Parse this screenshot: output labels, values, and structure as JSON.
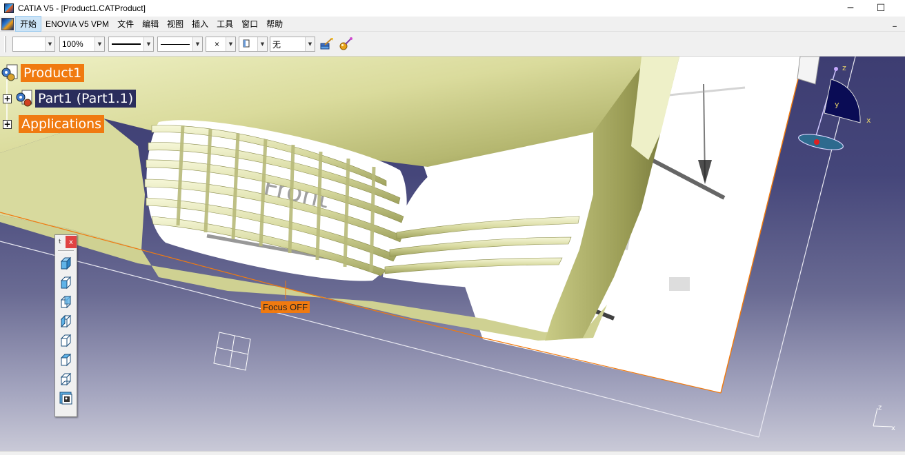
{
  "window": {
    "title": "CATIA V5 - [Product1.CATProduct]",
    "minimize_glyph": "─",
    "maximize_glyph": "☐"
  },
  "menu": {
    "items": [
      "开始",
      "ENOVIA V5 VPM",
      "文件",
      "编辑",
      "视图",
      "插入",
      "工具",
      "窗口",
      "帮助"
    ],
    "mdi_minimize": "_"
  },
  "toolbar": {
    "color_value": "",
    "zoom_value": "100%",
    "layer_value": "无",
    "point_style_glyph": "×"
  },
  "tree": {
    "root_label": "Product1",
    "part_label": "Part1 (Part1.1)",
    "applications_label": "Applications",
    "expand_glyph": "+"
  },
  "viewport": {
    "focus_label": "Focus OFF",
    "compass_z": "z",
    "compass_y": "y",
    "compass_x": "x",
    "axis_z": "z",
    "axis_x": "x"
  },
  "view_toolbar": {
    "title": "t",
    "close_glyph": "x",
    "buttons": [
      "isometric-view",
      "front-view",
      "back-view",
      "left-view",
      "right-view",
      "top-view",
      "bottom-view",
      "named-views"
    ]
  },
  "colors": {
    "tree_orange": "#f07a10",
    "tree_selected": "#2a2d5c",
    "part_surface": "#e6e7b1",
    "background_top": "#3d3d72",
    "background_bottom": "#c9c9d7"
  }
}
